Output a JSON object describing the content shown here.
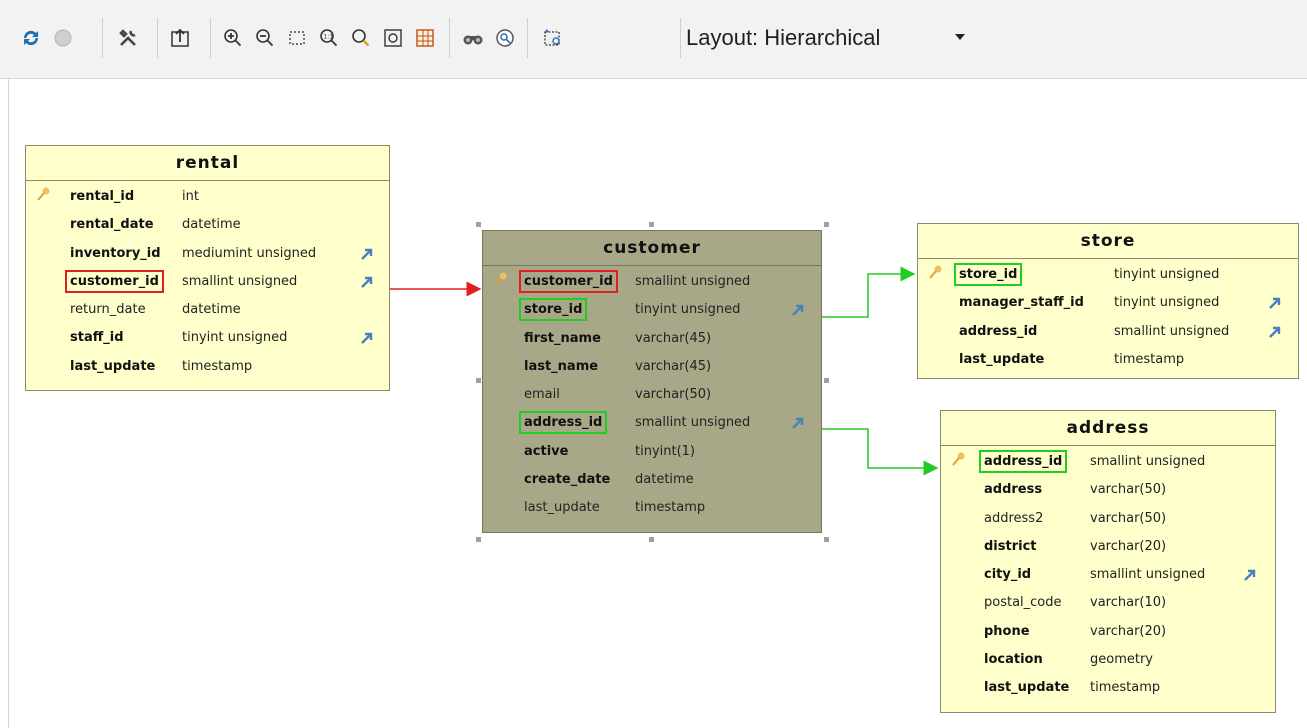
{
  "toolbar": {
    "layout_label": "Layout: Hierarchical",
    "icons": [
      "refresh-icon",
      "stop-icon",
      "tools-icon",
      "export-icon",
      "zoom-in-icon",
      "zoom-out-icon",
      "select-rect-icon",
      "zoom-fit-icon",
      "zoom-search-icon",
      "fit-page-icon",
      "grid-icon",
      "find-icon",
      "filter-icon",
      "layout-icon"
    ]
  },
  "colors": {
    "table_bg": "#ffffcc",
    "selected_table_bg": "#a8a888",
    "red_highlight": "#e02020",
    "green_highlight": "#22cc22",
    "fk_arrow": "#4a7fc1"
  },
  "tables": {
    "rental": {
      "title": "rental",
      "rows": [
        {
          "name": "rental_id",
          "type": "int"
        },
        {
          "name": "rental_date",
          "type": "datetime"
        },
        {
          "name": "inventory_id",
          "type": "mediumint unsigned"
        },
        {
          "name": "customer_id",
          "type": "smallint unsigned"
        },
        {
          "name": "return_date",
          "type": "datetime"
        },
        {
          "name": "staff_id",
          "type": "tinyint unsigned"
        },
        {
          "name": "last_update",
          "type": "timestamp"
        }
      ]
    },
    "customer": {
      "title": "customer",
      "rows": [
        {
          "name": "customer_id",
          "type": "smallint unsigned"
        },
        {
          "name": "store_id",
          "type": "tinyint unsigned"
        },
        {
          "name": "first_name",
          "type": "varchar(45)"
        },
        {
          "name": "last_name",
          "type": "varchar(45)"
        },
        {
          "name": "email",
          "type": "varchar(50)"
        },
        {
          "name": "address_id",
          "type": "smallint unsigned"
        },
        {
          "name": "active",
          "type": "tinyint(1)"
        },
        {
          "name": "create_date",
          "type": "datetime"
        },
        {
          "name": "last_update",
          "type": "timestamp"
        }
      ]
    },
    "store": {
      "title": "store",
      "rows": [
        {
          "name": "store_id",
          "type": "tinyint unsigned"
        },
        {
          "name": "manager_staff_id",
          "type": "tinyint unsigned"
        },
        {
          "name": "address_id",
          "type": "smallint unsigned"
        },
        {
          "name": "last_update",
          "type": "timestamp"
        }
      ]
    },
    "address": {
      "title": "address",
      "rows": [
        {
          "name": "address_id",
          "type": "smallint unsigned"
        },
        {
          "name": "address",
          "type": "varchar(50)"
        },
        {
          "name": "address2",
          "type": "varchar(50)"
        },
        {
          "name": "district",
          "type": "varchar(20)"
        },
        {
          "name": "city_id",
          "type": "smallint unsigned"
        },
        {
          "name": "postal_code",
          "type": "varchar(10)"
        },
        {
          "name": "phone",
          "type": "varchar(20)"
        },
        {
          "name": "location",
          "type": "geometry"
        },
        {
          "name": "last_update",
          "type": "timestamp"
        }
      ]
    }
  }
}
